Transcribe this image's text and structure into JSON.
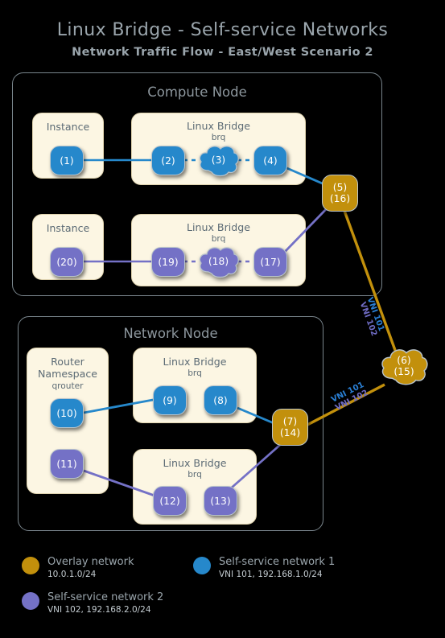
{
  "header": {
    "title": "Linux Bridge - Self-service Networks",
    "subtitle": "Network Traffic Flow - East/West Scenario 2"
  },
  "compute_node": {
    "title": "Compute Node",
    "instance1": {
      "title": "Instance",
      "node": "(1)"
    },
    "bridge1": {
      "title": "Linux Bridge",
      "sub": "brq",
      "nodes": [
        "(2)",
        "(3)",
        "(4)"
      ]
    },
    "instance2": {
      "title": "Instance",
      "node": "(20)"
    },
    "bridge2": {
      "title": "Linux Bridge",
      "sub": "brq",
      "nodes": [
        "(19)",
        "(18)",
        "(17)"
      ]
    }
  },
  "network_node": {
    "title": "Network Node",
    "router_namespace": {
      "title1": "Router",
      "title2": "Namespace",
      "sub": "qrouter",
      "node_blue": "(10)",
      "node_purple": "(11)"
    },
    "bridge1": {
      "title": "Linux Bridge",
      "sub": "brq",
      "nodes": [
        "(9)",
        "(8)"
      ]
    },
    "bridge2": {
      "title": "Linux Bridge",
      "sub": "brq",
      "nodes": [
        "(12)",
        "(13)"
      ]
    }
  },
  "overlay_nodes": {
    "compute_uplink": {
      "line1": "(5)",
      "line2": "(16)"
    },
    "overlay_cloud": {
      "line1": "(6)",
      "line2": "(15)"
    },
    "network_uplink": {
      "line1": "(7)",
      "line2": "(14)"
    }
  },
  "tunnel_labels": {
    "upper_vni101": "VNI 101",
    "upper_vni102": "VNI 102",
    "lower_vni101": "VNI 101",
    "lower_vni102": "VNI 102"
  },
  "legend": {
    "overlay": {
      "name": "Overlay network",
      "detail": "10.0.1.0/24",
      "color": "#c2900c"
    },
    "selfservice1": {
      "name": "Self-service network 1",
      "detail": "VNI 101, 192.168.1.0/24",
      "color": "#2688cb"
    },
    "selfservice2": {
      "name": "Self-service network 2",
      "detail": "VNI 102, 192.168.2.0/24",
      "color": "#7471c6"
    }
  },
  "colors": {
    "blue": "#2688cb",
    "purple": "#7471c6",
    "gold": "#c2900c",
    "panel_bg": "#fcf6e3",
    "background": "#000000"
  }
}
